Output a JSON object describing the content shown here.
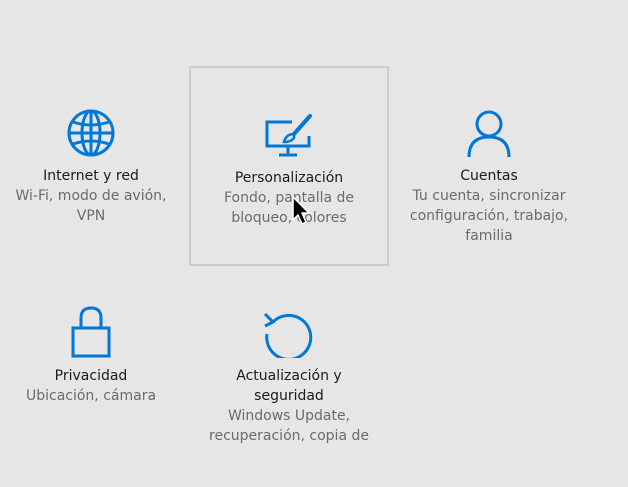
{
  "tiles": {
    "internet": {
      "title": "Internet y red",
      "desc": [
        "Wi-Fi, modo de avión,",
        "VPN"
      ],
      "icon": "globe-icon"
    },
    "personalizacion": {
      "title": "Personalización",
      "desc": [
        "Fondo, pantalla de",
        "bloqueo, colores"
      ],
      "icon": "monitor-brush-icon"
    },
    "cuentas": {
      "title": "Cuentas",
      "desc": [
        "Tu cuenta, sincronizar",
        "configuración, trabajo,",
        "familia"
      ],
      "icon": "person-icon"
    },
    "privacidad": {
      "title": "Privacidad",
      "desc": [
        "Ubicación, cámara"
      ],
      "icon": "lock-icon"
    },
    "actualizacion": {
      "title": [
        "Actualización y",
        "seguridad"
      ],
      "desc": [
        "Windows Update,",
        "recuperación, copia de"
      ],
      "icon": "refresh-icon"
    }
  },
  "colors": {
    "accent": "#0078d7",
    "background": "#e6e6e6",
    "title_text": "#1a1a1a",
    "desc_text": "#6b6b6b",
    "hover_border": "#cccccc"
  }
}
